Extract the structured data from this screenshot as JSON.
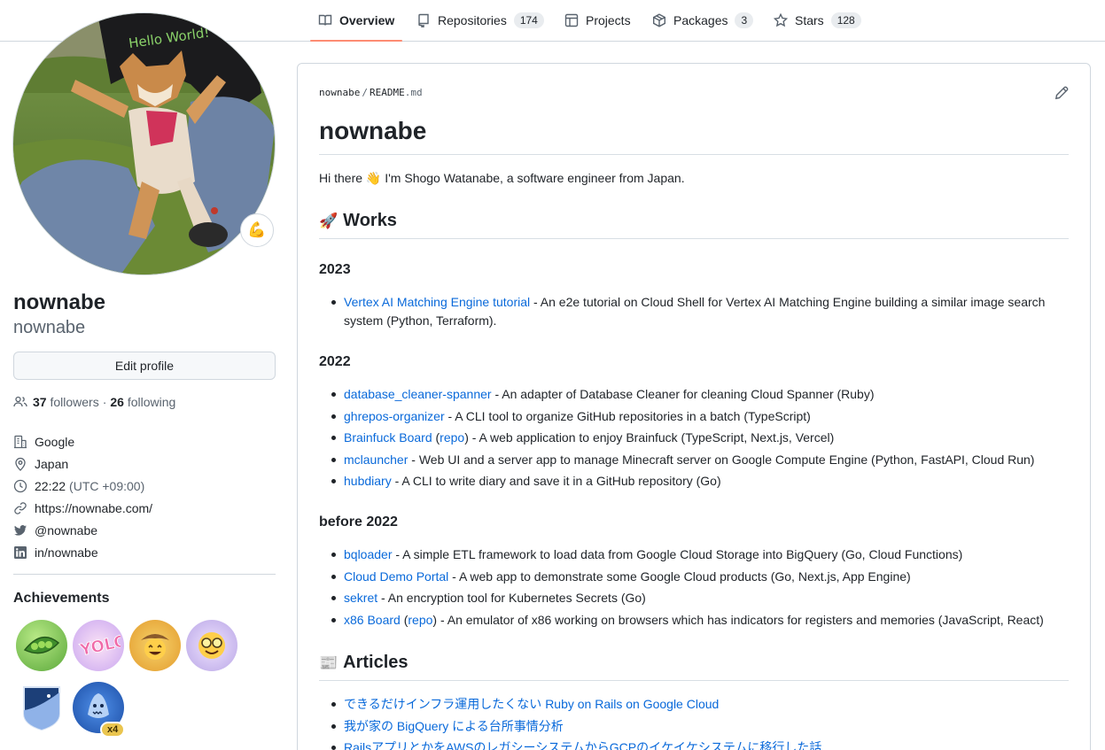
{
  "tabs": [
    {
      "label": "Overview",
      "counter": null,
      "icon": "book-icon",
      "selected": true
    },
    {
      "label": "Repositories",
      "counter": "174",
      "icon": "repo-icon"
    },
    {
      "label": "Projects",
      "counter": null,
      "icon": "table-icon"
    },
    {
      "label": "Packages",
      "counter": "3",
      "icon": "package-icon"
    },
    {
      "label": "Stars",
      "counter": "128",
      "icon": "star-icon"
    }
  ],
  "profile": {
    "avatar_alt": "avatar-photo",
    "status_emoji": "💪",
    "fullname": "nownabe",
    "username": "nownabe",
    "edit_label": "Edit profile",
    "followers_count": "37",
    "followers_label": "followers",
    "separator": "·",
    "following_count": "26",
    "following_label": "following",
    "company": "Google",
    "location": "Japan",
    "time": "22:22",
    "timezone": "(UTC +09:00)",
    "website": "https://nownabe.com/",
    "twitter": "@nownabe",
    "linkedin": "in/nownabe"
  },
  "achievements": {
    "title": "Achievements",
    "badges": [
      "pair-extraordinaire",
      "yolo",
      "starstruck",
      "quickdraw",
      "arctic-code-vault",
      "pull-shark"
    ],
    "pull_shark_multiplier": "x4"
  },
  "readme": {
    "path_owner": "nownabe",
    "path_sep": "/",
    "path_file": "README",
    "path_ext": ".md",
    "title": "nownabe",
    "intro_before": "Hi there ",
    "intro_emoji": "👋",
    "intro_after": " I'm Shogo Watanabe, a software engineer from Japan.",
    "works_emoji": "🚀",
    "works_title": "Works",
    "year_2023": "2023",
    "works_2023": [
      {
        "link": "Vertex AI Matching Engine tutorial",
        "desc": " - An e2e tutorial on Cloud Shell for Vertex AI Matching Engine building a similar image search system (Python, Terraform)."
      }
    ],
    "year_2022": "2022",
    "works_2022": [
      {
        "link": "database_cleaner-spanner",
        "desc": " - An adapter of Database Cleaner for cleaning Cloud Spanner (Ruby)"
      },
      {
        "link": "ghrepos-organizer",
        "desc": " - A CLI tool to organize GitHub repositories in a batch (TypeScript)"
      },
      {
        "link": "Brainfuck Board",
        "pre": " (",
        "link2": "repo",
        "desc": ") - A web application to enjoy Brainfuck (TypeScript, Next.js, Vercel)"
      },
      {
        "link": "mclauncher",
        "desc": " - Web UI and a server app to manage Minecraft server on Google Compute Engine (Python, FastAPI, Cloud Run)"
      },
      {
        "link": "hubdiary",
        "desc": " - A CLI to write diary and save it in a GitHub repository (Go)"
      }
    ],
    "year_before": "before 2022",
    "works_before": [
      {
        "link": "bqloader",
        "desc": " - A simple ETL framework to load data from Google Cloud Storage into BigQuery (Go, Cloud Functions)"
      },
      {
        "link": "Cloud Demo Portal",
        "desc": " - A web app to demonstrate some Google Cloud products (Go, Next.js, App Engine)"
      },
      {
        "link": "sekret",
        "desc": " - An encryption tool for Kubernetes Secrets (Go)"
      },
      {
        "link": "x86 Board",
        "pre": " (",
        "link2": "repo",
        "desc": ") - An emulator of x86 working on browsers which has indicators for registers and memories (JavaScript, React)"
      }
    ],
    "articles_emoji": "📰",
    "articles_title": "Articles",
    "articles": [
      {
        "link": "できるだけインフラ運用したくない Ruby on Rails on Google Cloud"
      },
      {
        "link": "我が家の BigQuery による台所事情分析"
      },
      {
        "link": "RailsアプリとかをAWSのレガシーシステムからGCPのイケイケシステムに移行した話"
      }
    ]
  },
  "colors": {
    "link": "#0969da",
    "tab_underline": "#fd8c73",
    "border": "#d0d7de",
    "muted": "#59636e"
  }
}
